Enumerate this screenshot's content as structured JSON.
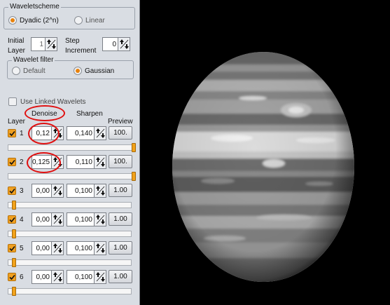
{
  "wavelet_scheme": {
    "title": "Waveletscheme",
    "options": [
      {
        "label": "Dyadic (2^n)",
        "selected": true
      },
      {
        "label": "Linear",
        "selected": false
      }
    ]
  },
  "initial_layer": {
    "label_line1": "Initial",
    "label_line2": "Layer",
    "value": "1"
  },
  "step_increment": {
    "label_line1": "Step",
    "label_line2": "Increment",
    "value": "0"
  },
  "wavelet_filter": {
    "title": "Wavelet filter",
    "options": [
      {
        "label": "Default",
        "selected": false
      },
      {
        "label": "Gaussian",
        "selected": true
      }
    ]
  },
  "use_linked_wavelets": {
    "label": "Use Linked Wavelets",
    "checked": false
  },
  "headers": {
    "layer": "Layer",
    "denoise": "Denoise",
    "sharpen": "Sharpen",
    "preview": "Preview"
  },
  "layers": [
    {
      "number": "1",
      "checked": true,
      "denoise": "0,12",
      "sharpen": "0,140",
      "preview": "100.",
      "slider": 1.0
    },
    {
      "number": "2",
      "checked": true,
      "denoise": "0,125",
      "sharpen": "0,110",
      "preview": "100.",
      "slider": 1.0
    },
    {
      "number": "3",
      "checked": true,
      "denoise": "0,00",
      "sharpen": "0,100",
      "preview": "1.00",
      "slider": 0.0
    },
    {
      "number": "4",
      "checked": true,
      "denoise": "0,00",
      "sharpen": "0,100",
      "preview": "1.00",
      "slider": 0.0
    },
    {
      "number": "5",
      "checked": true,
      "denoise": "0,00",
      "sharpen": "0,100",
      "preview": "1.00",
      "slider": 0.0
    },
    {
      "number": "6",
      "checked": true,
      "denoise": "0,00",
      "sharpen": "0,100",
      "preview": "1.00",
      "slider": 0.0
    }
  ],
  "colors": {
    "accent": "#f0a020",
    "highlight": "#e01010",
    "panel": "#d9dde3"
  }
}
